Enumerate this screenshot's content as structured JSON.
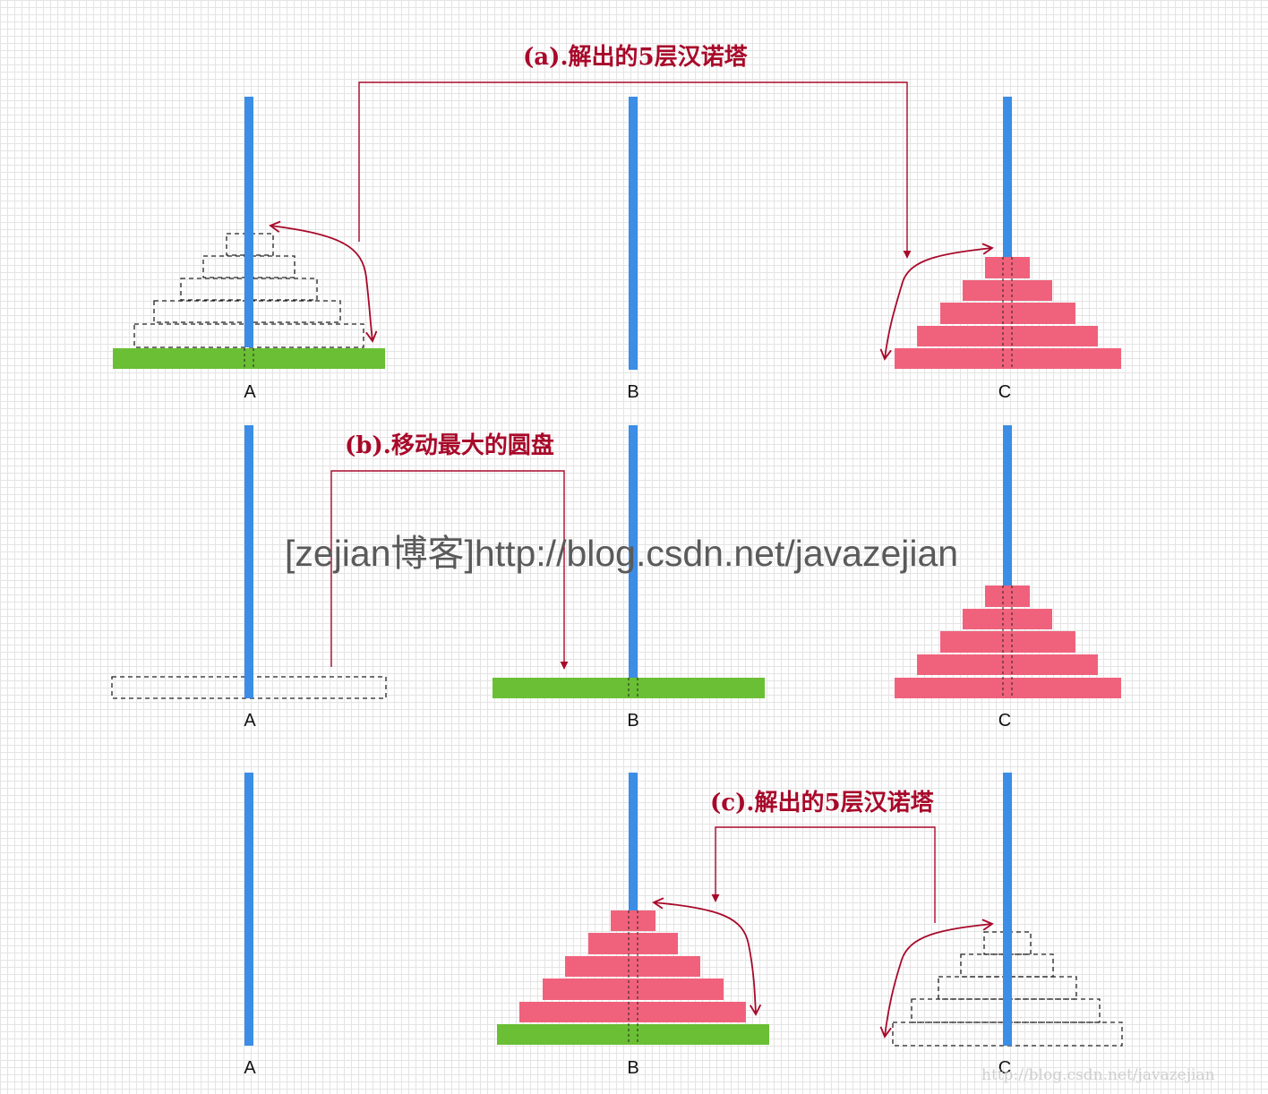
{
  "colors": {
    "peg": "#3b8de6",
    "base_disk": "#6abf34",
    "stack_disk": "#f0627c",
    "ghost_outline": "#222222",
    "annotation": "#a8092a"
  },
  "annotations": {
    "a": "(a).解出的5层汉诺塔",
    "b": "(b).移动最大的圆盘",
    "c": "(c).解出的5层汉诺塔"
  },
  "peg_labels": {
    "row1": [
      "A",
      "B",
      "C"
    ],
    "row2": [
      "A",
      "B",
      "C"
    ],
    "row3": [
      "A",
      "B",
      "C"
    ]
  },
  "watermark": "[zejian博客]http://blog.csdn.net/javazejian",
  "footer_watermark": "http://blog.csdn.net/javazejian"
}
